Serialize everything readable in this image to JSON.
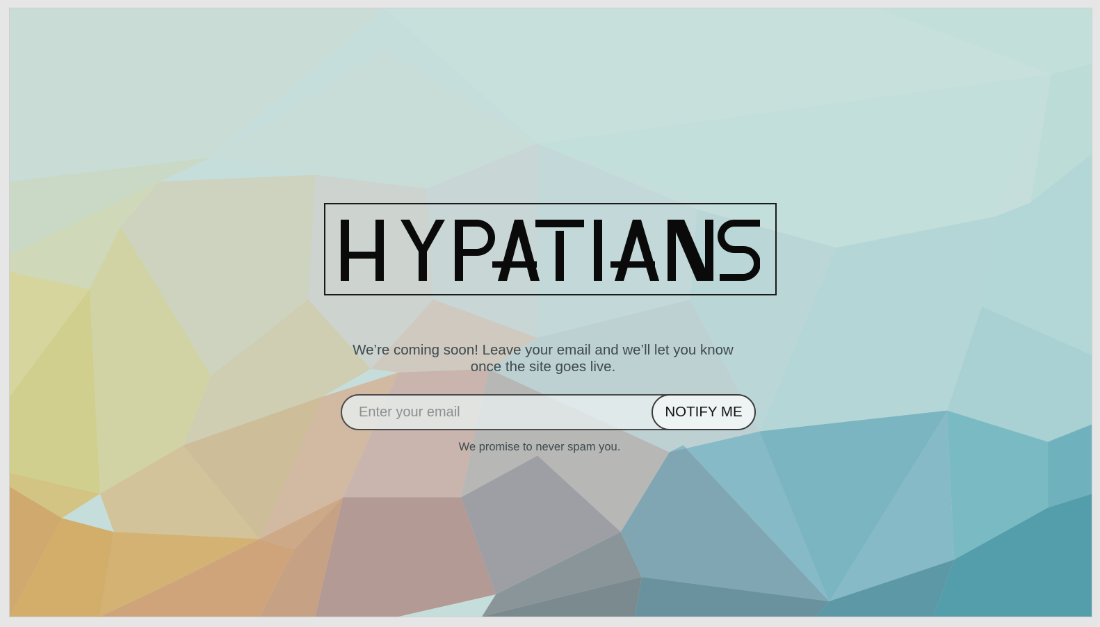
{
  "brand": {
    "logo_text": "HYPATIANS"
  },
  "message": {
    "line1": "We’re coming soon! Leave your email and we’ll let you know",
    "line2": "once the site goes live."
  },
  "signup": {
    "email_placeholder": "Enter your email",
    "email_value": "",
    "notify_label": "NOTIFY ME"
  },
  "footnote": {
    "text": "We promise to never spam you."
  },
  "theme": {
    "logo_color": "#0a0a0a",
    "text_color": "#3e4a4d",
    "background": "low-poly gradient teal-to-yellow"
  }
}
